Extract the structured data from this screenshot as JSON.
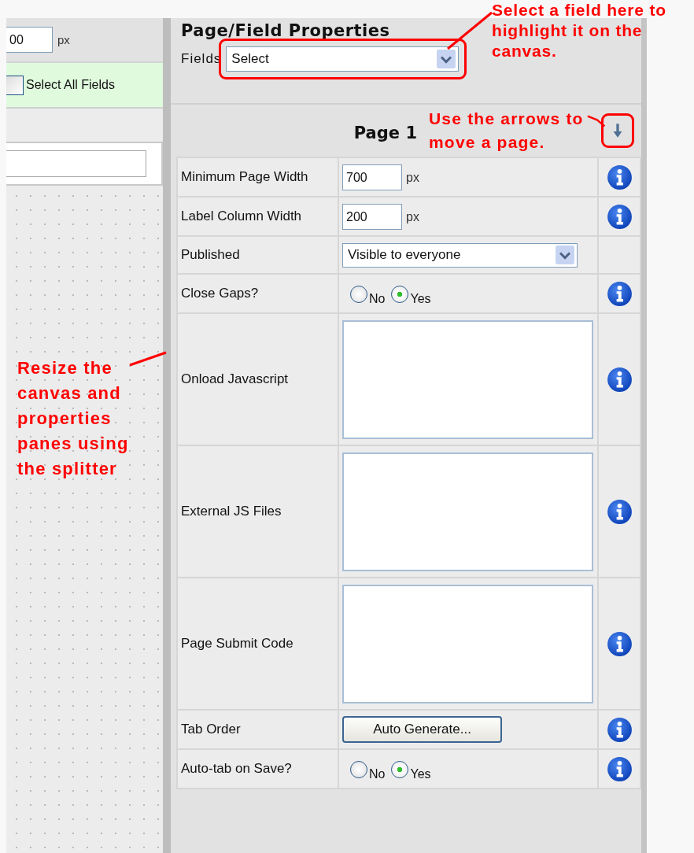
{
  "canvas_pane": {
    "width_input": {
      "value": "00"
    },
    "unit": "px",
    "select_all": {
      "label": "Select All Fields",
      "checked": false
    }
  },
  "properties_pane": {
    "title": "Page/Field Properties",
    "fields_label": "Fields",
    "fields_select": {
      "value": "Select"
    },
    "page_title": "Page 1",
    "rows": [
      {
        "kind": "input",
        "label": "Minimum Page Width",
        "value": "700",
        "unit": "px",
        "info": true
      },
      {
        "kind": "input",
        "label": "Label Column Width",
        "value": "200",
        "unit": "px",
        "info": true
      },
      {
        "kind": "select",
        "label": "Published",
        "value": "Visible to everyone",
        "info": false
      },
      {
        "kind": "radio",
        "label": "Close Gaps?",
        "options": [
          {
            "label": "No",
            "selected": false
          },
          {
            "label": "Yes",
            "selected": true
          }
        ],
        "info": true
      },
      {
        "kind": "textarea",
        "label": "Onload Javascript",
        "info": true
      },
      {
        "kind": "textarea",
        "label": "External JS Files",
        "info": true
      },
      {
        "kind": "textarea",
        "label": "Page Submit Code",
        "info": true
      },
      {
        "kind": "button",
        "label": "Tab Order",
        "button": "Auto Generate...",
        "info": true
      },
      {
        "kind": "radio",
        "label": "Auto-tab on Save?",
        "options": [
          {
            "label": "No",
            "selected": false
          },
          {
            "label": "Yes",
            "selected": true
          }
        ],
        "info": true
      }
    ]
  },
  "annotations": [
    {
      "kind": "fields",
      "text": "Select a field here to highlight it on the canvas."
    },
    {
      "kind": "arrows",
      "text": "Use the arrows to move a page."
    },
    {
      "kind": "splitter",
      "text": "Resize the canvas and properties panes using the splitter"
    }
  ]
}
